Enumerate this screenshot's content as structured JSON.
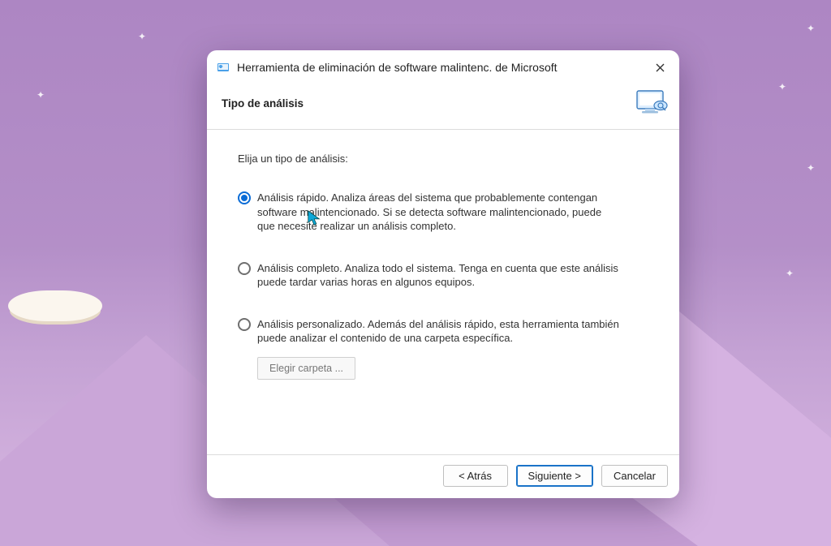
{
  "window": {
    "title": "Herramienta de eliminación de software malintenc. de Microsoft",
    "section_title": "Tipo de análisis",
    "prompt": "Elija un tipo de análisis:"
  },
  "options": {
    "quick": {
      "selected": true,
      "text": "Análisis rápido. Analiza áreas del sistema que probablemente contengan software malintencionado. Si se detecta software malintencionado, puede que necesite realizar un análisis completo."
    },
    "full": {
      "selected": false,
      "text": "Análisis completo. Analiza todo el sistema. Tenga en cuenta que este análisis puede tardar varias horas en algunos equipos."
    },
    "custom": {
      "selected": false,
      "text": "Análisis personalizado. Además del análisis rápido, esta herramienta también puede analizar el contenido de una carpeta específica."
    }
  },
  "buttons": {
    "choose_folder": "Elegir carpeta ...",
    "back": "< Atrás",
    "next": "Siguiente >",
    "cancel": "Cancelar"
  }
}
